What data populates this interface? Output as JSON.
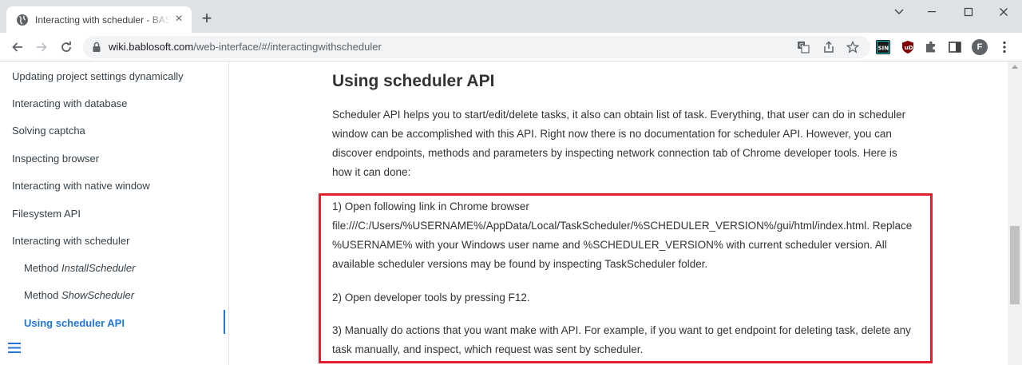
{
  "tab": {
    "title": "Interacting with scheduler - BAS",
    "close_icon": "close-icon",
    "new_tab_icon": "plus-icon"
  },
  "window": {
    "controls": [
      "chevron-down-icon",
      "minimize-icon",
      "maximize-icon",
      "close-icon"
    ]
  },
  "toolbar": {
    "url_host": "wiki.bablosoft.com",
    "url_path": "/web-interface/#/interactingwithscheduler",
    "profile_initial": "F",
    "extensions": [
      "sin-extension-icon",
      "ublock-icon",
      "puzzle-icon"
    ]
  },
  "sidebar": {
    "items": [
      {
        "label": "Updating project settings dynamically"
      },
      {
        "label": "Interacting with database"
      },
      {
        "label": "Solving captcha"
      },
      {
        "label": "Inspecting browser"
      },
      {
        "label": "Interacting with native window"
      },
      {
        "label": "Filesystem API"
      },
      {
        "label": "Interacting with scheduler"
      }
    ],
    "sub_items": [
      {
        "prefix": "Method ",
        "name": "InstallScheduler"
      },
      {
        "prefix": "Method ",
        "name": "ShowScheduler"
      },
      {
        "label": "Using scheduler API"
      }
    ]
  },
  "content": {
    "title": "Using scheduler API",
    "intro": "Scheduler API helps you to start/edit/delete tasks, it also can obtain list of task. Everything, that user can do in scheduler window can be accomplished with this API. Right now there is no documentation for scheduler API. However, you can discover endpoints, methods and parameters by inspecting network connection tab of Chrome developer tools. Here is how it can done:",
    "step1_line1": "1) Open following link in Chrome browser",
    "step1_line2": "file:///C:/Users/%USERNAME%/AppData/Local/TaskScheduler/%SCHEDULER_VERSION%/gui/html/index.html. Replace %USERNAME% with your Windows user name and %SCHEDULER_VERSION% with current scheduler version. All available scheduler versions may be found by inspecting TaskScheduler folder.",
    "step2": "2) Open developer tools by pressing F12.",
    "step3": "3) Manually do actions that you want make with API. For example, if you want to get endpoint for deleting task, delete any task manually, and inspect, which request was sent by scheduler."
  },
  "colors": {
    "accent": "#2175d9",
    "highlight_box": "#e01e2c",
    "tabstrip": "#dee1e6"
  }
}
